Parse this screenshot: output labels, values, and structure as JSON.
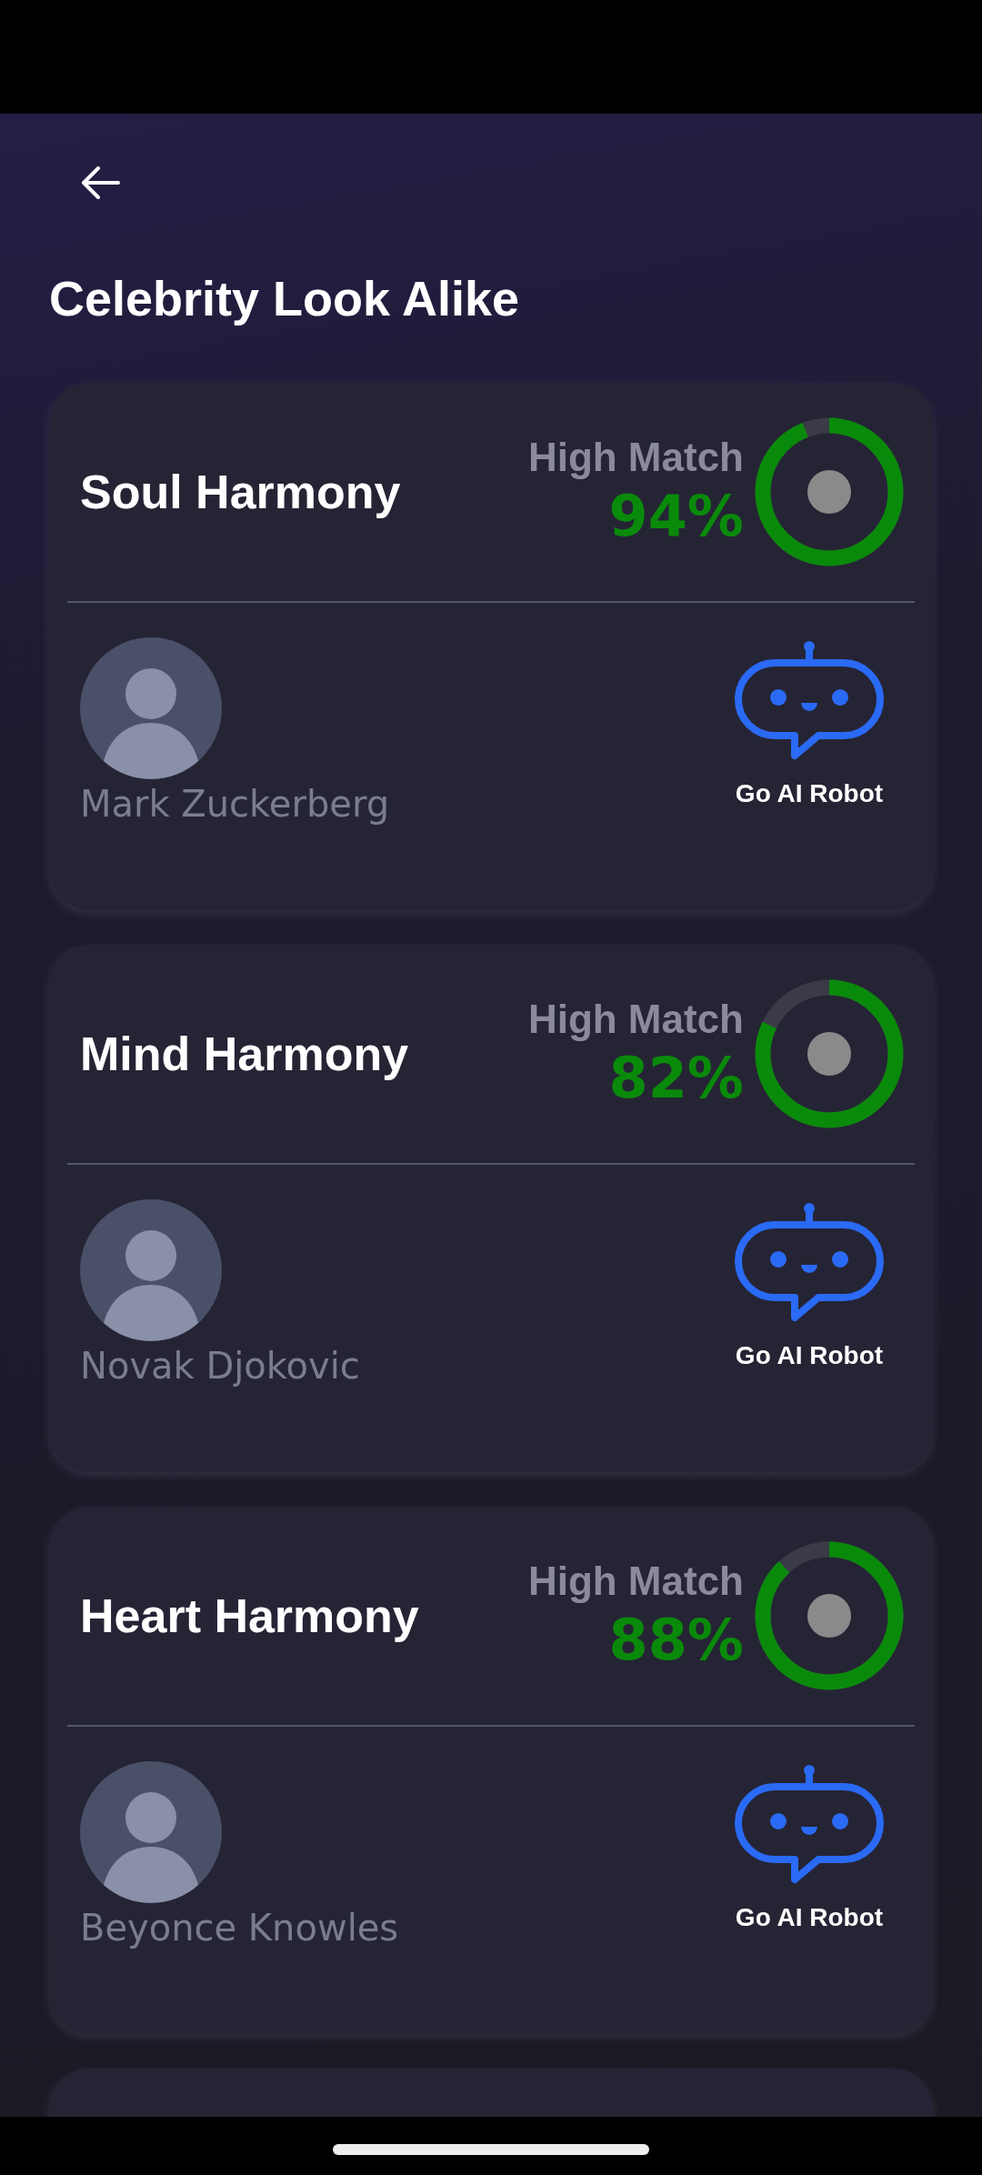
{
  "title": "Celebrity Look Alike",
  "matches": [
    {
      "title": "Soul Harmony",
      "match_label": "High Match",
      "percent": "94%",
      "level": 0.94,
      "celebrity": "Mark Zuckerberg",
      "action": "Go AI Robot"
    },
    {
      "title": "Mind Harmony",
      "match_label": "High Match",
      "percent": "82%",
      "level": 0.82,
      "celebrity": "Novak Djokovic",
      "action": "Go AI Robot"
    },
    {
      "title": "Heart Harmony",
      "match_label": "High Match",
      "percent": "88%",
      "level": 0.88,
      "celebrity": "Beyonce Knowles",
      "action": "Go AI Robot"
    }
  ]
}
